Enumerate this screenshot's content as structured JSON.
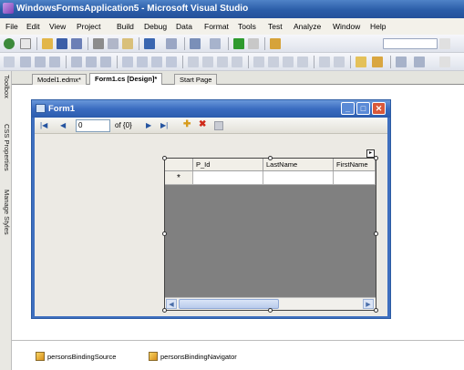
{
  "window": {
    "title": "WindowsFormsApplication5 - Microsoft Visual Studio"
  },
  "menu": [
    "File",
    "Edit",
    "View",
    "Project",
    "Build",
    "Debug",
    "Data",
    "Format",
    "Tools",
    "Test",
    "Analyze",
    "Window",
    "Help"
  ],
  "side_tabs": [
    "Toolbox",
    "CSS Properties",
    "Manage Styles"
  ],
  "doc_tabs": [
    "Model1.edmx*",
    "Form1.cs [Design]*",
    "Start Page"
  ],
  "active_tab": "Form1.cs [Design]*",
  "form": {
    "title": "Form1",
    "navigator": {
      "position": "0",
      "count_label": "of {0}"
    },
    "grid": {
      "columns": [
        "P_Id",
        "LastName",
        "FirstName"
      ],
      "new_row_marker": "*"
    }
  },
  "tray": [
    "personsBindingSource",
    "personsBindingNavigator"
  ],
  "colors": {
    "title_bar": "#2b5da8",
    "grid_bg": "#808080",
    "form_border": "#2c5ba3"
  },
  "icons": [
    "app-icon",
    "minimize-icon",
    "maximize-icon",
    "close-icon",
    "move-first-icon",
    "move-previous-icon",
    "move-next-icon",
    "move-last-icon",
    "add-new-icon",
    "delete-icon",
    "save-icon",
    "component-icon"
  ]
}
